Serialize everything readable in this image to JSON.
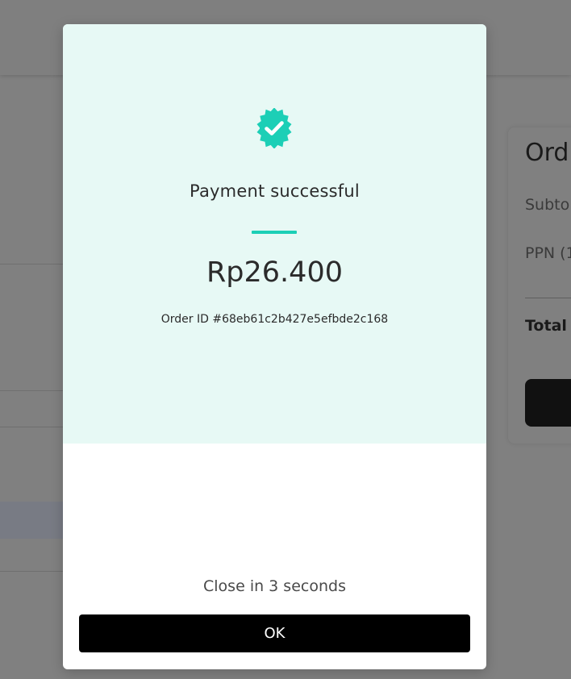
{
  "background": {
    "card": {
      "title": "Ord",
      "subtotal_label": "Subto",
      "tax_label": "PPN (1",
      "total_label": "Total"
    }
  },
  "modal": {
    "status_icon": "verified-check-badge-icon",
    "title": "Payment successful",
    "amount": "Rp26.400",
    "order_id": "Order ID #68eb61c2b427e5efbde2c168",
    "countdown": "Close in 3 seconds",
    "ok_label": "OK"
  },
  "colors": {
    "success_bg": "#e7f9f5",
    "accent": "#1ccfb6",
    "button_bg": "#000000",
    "overlay": "#808080"
  }
}
